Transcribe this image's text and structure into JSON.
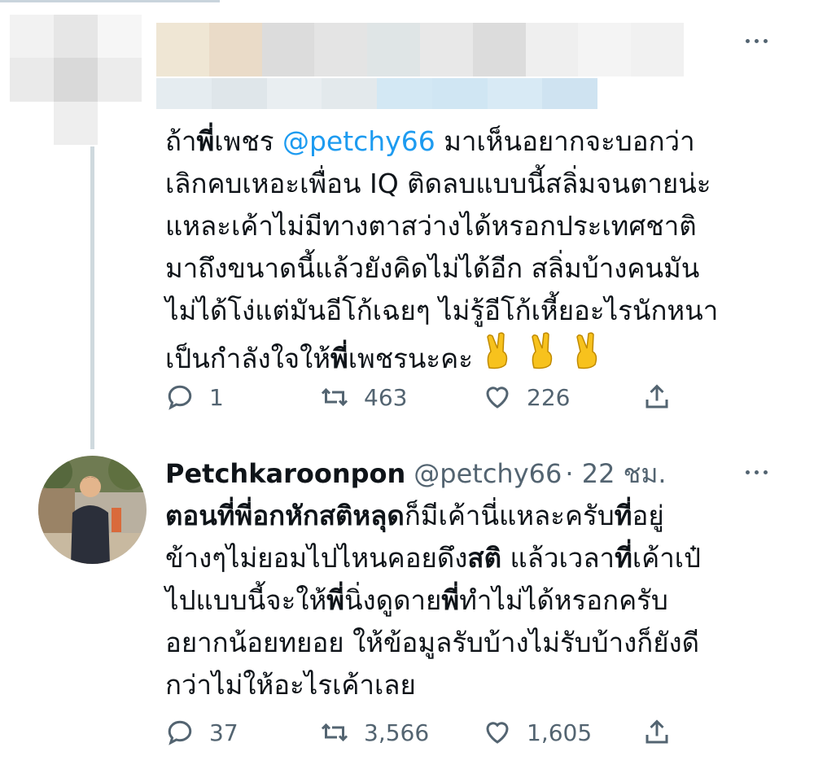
{
  "tweet1": {
    "text_parts": {
      "p1": "ถ้า",
      "p2": "พี่",
      "p3": "เพชร ",
      "mention": "@petchy66",
      "p4": " มาเห็นอยากจะบอกว่า",
      "line2": "เลิกคบเหอะเพื่อน IQ ติดลบแบบนี้สลิ่มจนตายน่ะ",
      "line3": "แหละเค้าไม่มีทางตาสว่างได้หรอกประเทศชาติ",
      "line4": "มาถึงขนาดนี้แล้วยังคิดไม่ได้อีก สลิ่มบ้างคนมัน",
      "line5": "ไม่ได้โง่แต่มันอีโก้เฉยๆ ไม่รู้อีโก้เหี้ยอะไรนักหนา",
      "line6a": "เป็นกำลังใจให้",
      "line6b": "พี่",
      "line6c": "เพชรนะคะ"
    },
    "emoji": "victory-hand-emoji x3",
    "replies": "1",
    "retweets": "463",
    "likes": "226"
  },
  "tweet2": {
    "name": "Petchkaroonpon",
    "handle": "@petchy66",
    "time": "· 22 ชม.",
    "text_parts": {
      "l1a": "ตอนที่พี่อกหักสติหลุด",
      "l1b": "ก็มีเค้านี่แหละครับ",
      "l1c": "ที่",
      "l1d": "อยู่",
      "l2a": "ข้างๆไม่ยอมไปไหนคอยดึง",
      "l2b": "สติ",
      "l2c": " แล้วเวลา",
      "l2d": "ที่",
      "l2e": "เค้าเป๋",
      "l3a": "ไปแบบนี้จะให้",
      "l3b": "พี่",
      "l3c": "นิ่งดูดาย",
      "l3d": "พี่",
      "l3e": "ทำไม่ได้หรอกครับ",
      "line4": "อยากน้อยทยอย ให้ข้อมูลรับบ้างไม่รับบ้างก็ยังดี",
      "line5": "กว่าไม่ให้อะไรเค้าเลย"
    },
    "replies": "37",
    "retweets": "3,566",
    "likes": "1,605"
  },
  "colors": {
    "text": "#0f1419",
    "secondary": "#536471",
    "mention": "#1d9bf0",
    "thread_line": "#cfd9de"
  }
}
